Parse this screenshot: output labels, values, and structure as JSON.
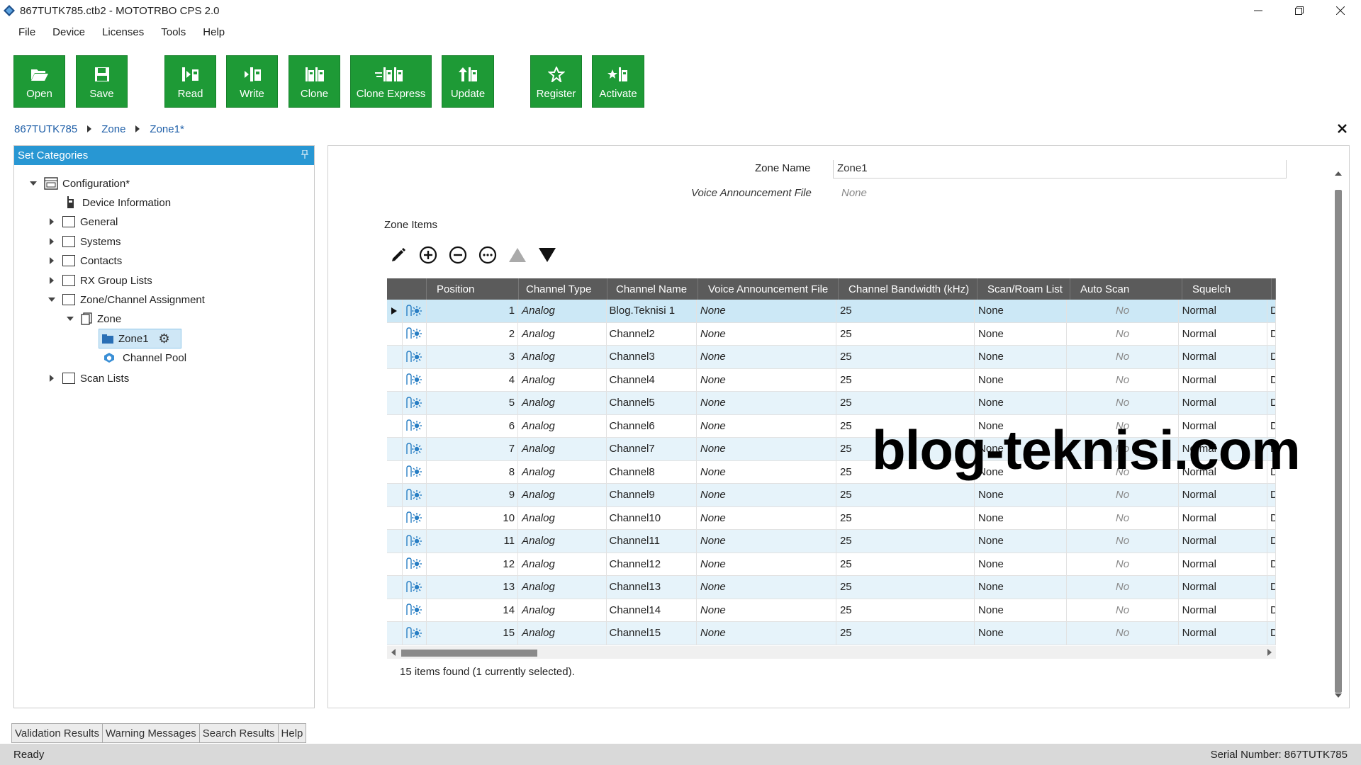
{
  "window": {
    "title": "867TUTK785.ctb2 - MOTOTRBO CPS 2.0",
    "controls": [
      "minimize",
      "restore",
      "close"
    ]
  },
  "menu": [
    "File",
    "Device",
    "Licenses",
    "Tools",
    "Help"
  ],
  "toolbar": {
    "color": "#1e9a36",
    "buttons": [
      {
        "label": "Open",
        "icon": "folder-open-icon"
      },
      {
        "label": "Save",
        "icon": "floppy-icon"
      },
      {
        "label": "Read",
        "icon": "read-radio-icon"
      },
      {
        "label": "Write",
        "icon": "write-radio-icon"
      },
      {
        "label": "Clone",
        "icon": "clone-icon"
      },
      {
        "label": "Clone Express",
        "icon": "clone-express-icon"
      },
      {
        "label": "Update",
        "icon": "update-icon"
      },
      {
        "label": "Register",
        "icon": "star-icon"
      },
      {
        "label": "Activate",
        "icon": "activate-icon"
      }
    ]
  },
  "breadcrumb": [
    "867TUTK785",
    "Zone",
    "Zone1*"
  ],
  "left_panel": {
    "title": "Set Categories",
    "header_color": "#2897d3",
    "tree": {
      "configuration": "Configuration*",
      "device_information": "Device Information",
      "general": "General",
      "systems": "Systems",
      "contacts": "Contacts",
      "rx_group_lists": "RX Group Lists",
      "zone_channel_assignment": "Zone/Channel Assignment",
      "zone": "Zone",
      "zone1": "Zone1",
      "channel_pool": "Channel Pool",
      "scan_lists": "Scan Lists"
    }
  },
  "zone_form": {
    "zone_name_label": "Zone Name",
    "zone_name_value": "Zone1",
    "vaf_label": "Voice Announcement File",
    "vaf_value": "None",
    "zone_items_label": "Zone Items"
  },
  "grid": {
    "columns": [
      "Position",
      "Channel Type",
      "Channel Name",
      "Voice Announcement File",
      "Channel Bandwidth (kHz)",
      "Scan/Roam List",
      "Auto Scan",
      "Squelch"
    ],
    "rows": [
      {
        "position": "1",
        "type": "Analog",
        "name": "Blog.Teknisi 1",
        "vaf": "None",
        "bw": "25",
        "scan": "None",
        "auto": "No",
        "squelch": "Normal",
        "more": "D"
      },
      {
        "position": "2",
        "type": "Analog",
        "name": "Channel2",
        "vaf": "None",
        "bw": "25",
        "scan": "None",
        "auto": "No",
        "squelch": "Normal",
        "more": "D"
      },
      {
        "position": "3",
        "type": "Analog",
        "name": "Channel3",
        "vaf": "None",
        "bw": "25",
        "scan": "None",
        "auto": "No",
        "squelch": "Normal",
        "more": "D"
      },
      {
        "position": "4",
        "type": "Analog",
        "name": "Channel4",
        "vaf": "None",
        "bw": "25",
        "scan": "None",
        "auto": "No",
        "squelch": "Normal",
        "more": "D"
      },
      {
        "position": "5",
        "type": "Analog",
        "name": "Channel5",
        "vaf": "None",
        "bw": "25",
        "scan": "None",
        "auto": "No",
        "squelch": "Normal",
        "more": "D"
      },
      {
        "position": "6",
        "type": "Analog",
        "name": "Channel6",
        "vaf": "None",
        "bw": "25",
        "scan": "None",
        "auto": "No",
        "squelch": "Normal",
        "more": "D"
      },
      {
        "position": "7",
        "type": "Analog",
        "name": "Channel7",
        "vaf": "None",
        "bw": "25",
        "scan": "None",
        "auto": "No",
        "squelch": "Normal",
        "more": "D"
      },
      {
        "position": "8",
        "type": "Analog",
        "name": "Channel8",
        "vaf": "None",
        "bw": "25",
        "scan": "None",
        "auto": "No",
        "squelch": "Normal",
        "more": "D"
      },
      {
        "position": "9",
        "type": "Analog",
        "name": "Channel9",
        "vaf": "None",
        "bw": "25",
        "scan": "None",
        "auto": "No",
        "squelch": "Normal",
        "more": "D"
      },
      {
        "position": "10",
        "type": "Analog",
        "name": "Channel10",
        "vaf": "None",
        "bw": "25",
        "scan": "None",
        "auto": "No",
        "squelch": "Normal",
        "more": "D"
      },
      {
        "position": "11",
        "type": "Analog",
        "name": "Channel11",
        "vaf": "None",
        "bw": "25",
        "scan": "None",
        "auto": "No",
        "squelch": "Normal",
        "more": "D"
      },
      {
        "position": "12",
        "type": "Analog",
        "name": "Channel12",
        "vaf": "None",
        "bw": "25",
        "scan": "None",
        "auto": "No",
        "squelch": "Normal",
        "more": "D"
      },
      {
        "position": "13",
        "type": "Analog",
        "name": "Channel13",
        "vaf": "None",
        "bw": "25",
        "scan": "None",
        "auto": "No",
        "squelch": "Normal",
        "more": "D"
      },
      {
        "position": "14",
        "type": "Analog",
        "name": "Channel14",
        "vaf": "None",
        "bw": "25",
        "scan": "None",
        "auto": "No",
        "squelch": "Normal",
        "more": "D"
      },
      {
        "position": "15",
        "type": "Analog",
        "name": "Channel15",
        "vaf": "None",
        "bw": "25",
        "scan": "None",
        "auto": "No",
        "squelch": "Normal",
        "more": "D"
      }
    ],
    "selected_row": 1,
    "items_found": "15 items found (1 currently selected)."
  },
  "watermark": "blog-teknisi.com",
  "bottom_tabs": [
    "Validation Results",
    "Warning Messages",
    "Search Results",
    "Help"
  ],
  "status": {
    "left": "Ready",
    "right": "Serial Number: 867TUTK785"
  }
}
